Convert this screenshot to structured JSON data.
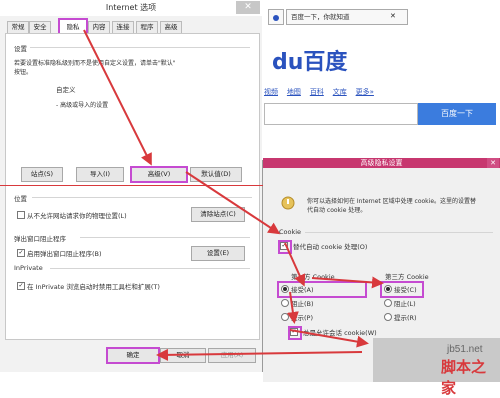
{
  "options_dialog": {
    "title": "Internet 选项",
    "close_glyph": "✕",
    "tabs": [
      "常规",
      "安全",
      "隐私",
      "内容",
      "连接",
      "程序",
      "高级"
    ],
    "settings_heading": "设置",
    "settings_desc_1": "若要设置标准隐私级别而不是使用自定义设置，请单击\"默认\"",
    "settings_desc_2": "按钮。",
    "custom_title": "自定义",
    "custom_desc": "- 高级或导入的设置",
    "buttons": {
      "site": "站点(S)",
      "import": "导入(I)",
      "advanced": "高级(V)",
      "default": "默认值(D)"
    },
    "location_heading": "位置",
    "location_checkbox": "从不允许网站请求你的物理位置(L)",
    "clear_sites_button": "清除站点(C)",
    "popup_heading": "弹出窗口阻止程序",
    "popup_checkbox": "启用弹出窗口阻止程序(B)",
    "settings_button": "设置(E)",
    "inprivate_heading": "InPrivate",
    "inprivate_checkbox": "在 InPrivate 浏览启动时禁用工具栏和扩展(T)",
    "ok_button": "确定",
    "cancel_button": "取消",
    "apply_button": "应用(A)"
  },
  "browser": {
    "tab_title": "百度一下，你就知道",
    "logo_text": "du百度",
    "nav_links": [
      "视频",
      "地图",
      "百科",
      "文库",
      "更多»"
    ],
    "search_button": "百度一下"
  },
  "advanced_dialog": {
    "title": "高级隐私设置",
    "close_glyph": "✕",
    "desc_1": "你可以选择如何在 Internet 区域中处理 cookie。这里的设置替",
    "desc_2": "代自动 cookie 处理。",
    "cookie_label": "Cookie",
    "override_checkbox": "替代自动 cookie 处理(O)",
    "first_party_label": "第一方 Cookie",
    "third_party_label": "第三方 Cookie",
    "first_options": [
      "接受(A)",
      "阻止(B)",
      "提示(P)"
    ],
    "third_options": [
      "接受(C)",
      "阻止(L)",
      "提示(R)"
    ],
    "session_checkbox": "总是允许会话 cookie(W)"
  },
  "watermark": {
    "site": "jb51.net",
    "name": "脚本之家"
  },
  "colors": {
    "highlight": "#c54bd1",
    "arrow": "#d8393c",
    "dialog_title": "#c7376f"
  }
}
